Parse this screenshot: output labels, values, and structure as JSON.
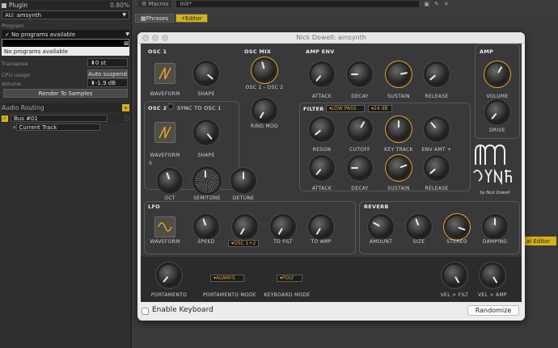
{
  "host": {
    "plugin_header": "Plugin",
    "plugin_cpu": "0.80%",
    "plugin_name": "AU: amsynth",
    "program_label": "Program",
    "program_value": "No programs available",
    "program_dropdown_item": "No programs available",
    "transpose_label": "Transpose",
    "transpose_value": "0 st",
    "cpu_label": "CPU usage",
    "cpu_button": "Auto suspend",
    "volume_label": "Volume",
    "volume_value": "-1.9 dB",
    "render_button": "Render To Samples",
    "routing_label": "Audio Routing",
    "bus_label": "Bus #01",
    "track_label": "Current Track",
    "macros_tab": "Macros",
    "preset_name": "Init*",
    "tab_phrases": "Phrases",
    "tab_editor": "Editor",
    "behind_editor": "al Editor"
  },
  "synth": {
    "window_title": "Nick Dowell: amsynth",
    "logo_subtitle": "by Nick Dowell",
    "osc1": {
      "title": "OSC 1",
      "waveform": "WAVEFORM",
      "shape": "SHAPE"
    },
    "osc2": {
      "title": "OSC 2",
      "sync": "SYNC TO OSC 1",
      "waveform": "WAVEFORM",
      "shape": "SHAPE",
      "oct": "OCT",
      "oct_mark": "0",
      "semitone": "SEMITONE",
      "detune": "DETUNE"
    },
    "oscmix": {
      "title": "OSC MIX",
      "mix": "OSC 1 - OSC 2",
      "ringmod": "RING MOD"
    },
    "ampenv": {
      "title": "AMP ENV",
      "attack": "ATTACK",
      "decay": "DECAY",
      "sustain": "SUSTAIN",
      "release": "RELEASE"
    },
    "amp": {
      "title": "AMP",
      "volume": "VOLUME",
      "drive": "DRIVE"
    },
    "filter": {
      "title": "FILTER",
      "type": "LOW PASS",
      "slope": "24 dB",
      "reson": "RESON",
      "cutoff": "CUTOFF",
      "keytrack": "KEY TRACK",
      "envamt": "ENV AMT +",
      "attack": "ATTACK",
      "decay": "DECAY",
      "sustain": "SUSTAIN",
      "release": "RELEASE"
    },
    "lfo": {
      "title": "LFO",
      "waveform": "WAVEFORM",
      "speed": "SPEED",
      "target": "OSC 1+2",
      "tofilt": "TO FILT",
      "toamp": "TO AMP"
    },
    "reverb": {
      "title": "REVERB",
      "amount": "AMOUNT",
      "size": "SIZE",
      "stereo": "STEREO",
      "damping": "DAMPING"
    },
    "lower": {
      "portamento": "PORTAMENTO",
      "porta_mode": "PORTAMENTO MODE",
      "porta_mode_value": "ALWAYS",
      "kb_mode": "KEYBOARD MODE",
      "kb_mode_value": "POLY",
      "vel_filt": "VEL > FILT",
      "vel_amp": "VEL > AMP"
    },
    "enable_keyboard": "Enable Keyboard",
    "randomize": "Randomize"
  }
}
